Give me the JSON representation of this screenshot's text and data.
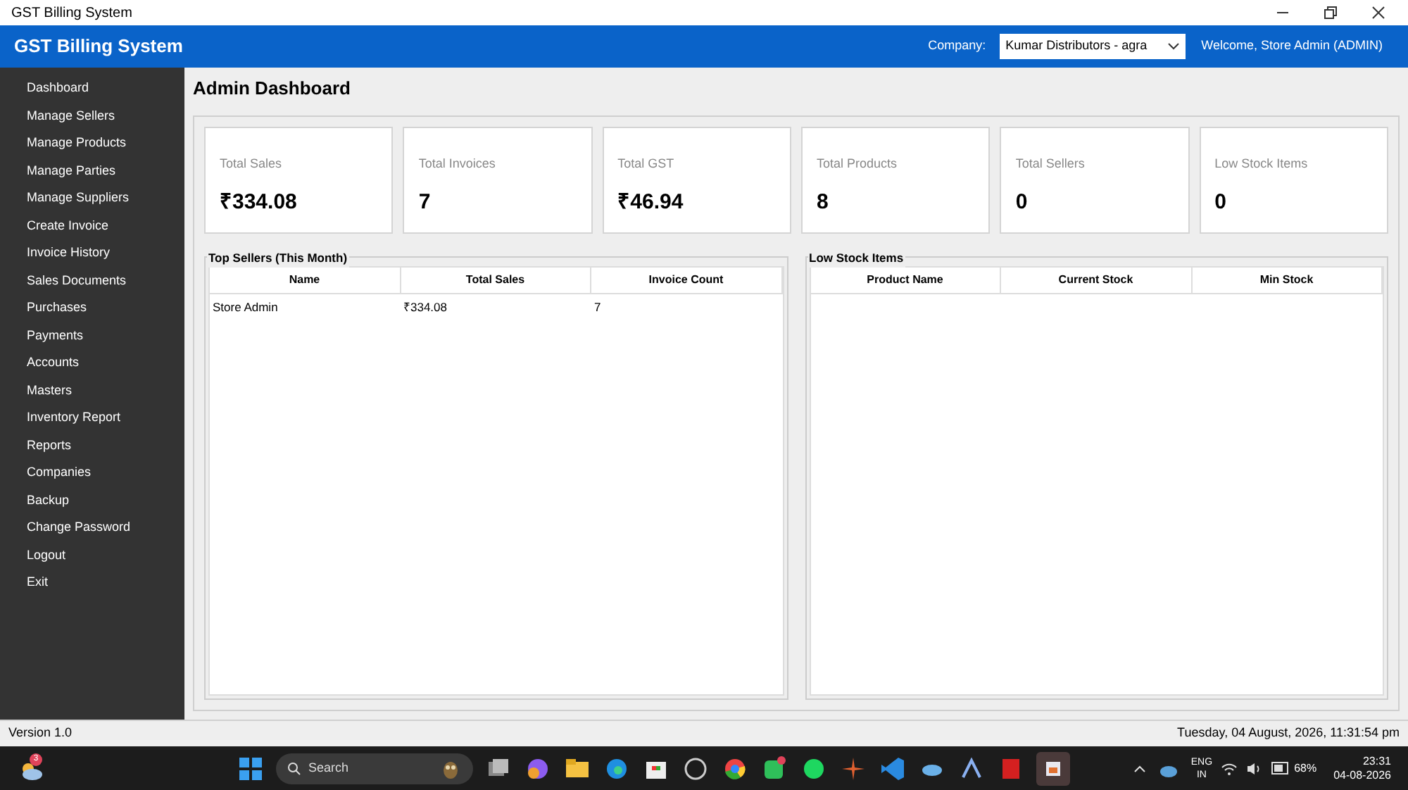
{
  "window": {
    "title": "GST Billing System"
  },
  "header": {
    "title": "GST Billing System",
    "company_label": "Company:",
    "company_value": "Kumar Distributors - agra",
    "welcome": "Welcome, Store Admin (ADMIN)"
  },
  "sidebar": {
    "items": [
      "Dashboard",
      "Manage Sellers",
      "Manage Products",
      "Manage Parties",
      "Manage Suppliers",
      "Create Invoice",
      "Invoice History",
      "Sales Documents",
      "Purchases",
      "Payments",
      "Accounts",
      "Masters",
      "Inventory Report",
      "Reports",
      "Companies",
      "Backup",
      "Change Password",
      "Logout",
      "Exit"
    ]
  },
  "page_title": "Admin Dashboard",
  "cards": [
    {
      "label": "Total Sales",
      "value": "₹334.08"
    },
    {
      "label": "Total Invoices",
      "value": "7"
    },
    {
      "label": "Total GST",
      "value": "₹46.94"
    },
    {
      "label": "Total Products",
      "value": "8"
    },
    {
      "label": "Total Sellers",
      "value": "0"
    },
    {
      "label": "Low Stock Items",
      "value": "0"
    }
  ],
  "tables": [
    {
      "title": "Top Sellers (This Month)",
      "columns": [
        "Name",
        "Total Sales",
        "Invoice Count"
      ],
      "rows": [
        [
          "Store Admin",
          "₹334.08",
          "7"
        ]
      ]
    },
    {
      "title": "Low Stock Items",
      "columns": [
        "Product Name",
        "Current Stock",
        "Min Stock"
      ]
    }
  ],
  "status_bar": {
    "version": "Version 1.0",
    "datetime": "Tuesday, 04 August, 2026, 11:31:54 pm"
  },
  "taskbar": {
    "weather_badge": "3",
    "search": "Search",
    "language": "ENG",
    "region": "IN",
    "battery": "68%",
    "time": "23:31",
    "date": "04-08-2026"
  }
}
